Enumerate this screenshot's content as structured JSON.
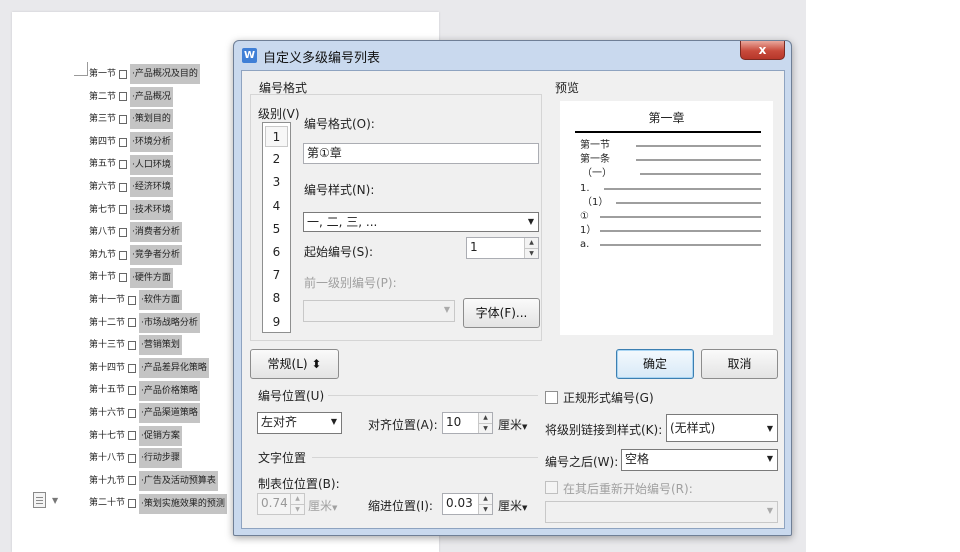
{
  "document": {
    "toc": [
      {
        "num": "第一节",
        "title": "·产品概况及目的"
      },
      {
        "num": "第二节",
        "title": "·产品概况"
      },
      {
        "num": "第三节",
        "title": "·策划目的"
      },
      {
        "num": "第四节",
        "title": "·环境分析"
      },
      {
        "num": "第五节",
        "title": "·人口环境"
      },
      {
        "num": "第六节",
        "title": "·经济环境"
      },
      {
        "num": "第七节",
        "title": "·技术环境"
      },
      {
        "num": "第八节",
        "title": "·消费者分析"
      },
      {
        "num": "第九节",
        "title": "·竞争者分析"
      },
      {
        "num": "第十节",
        "title": "·硬件方面"
      },
      {
        "num": "第十一节",
        "title": "·软件方面"
      },
      {
        "num": "第十二节",
        "title": "·市场战略分析"
      },
      {
        "num": "第十三节",
        "title": "·营销策划"
      },
      {
        "num": "第十四节",
        "title": "·产品差异化策略"
      },
      {
        "num": "第十五节",
        "title": "·产品价格策略"
      },
      {
        "num": "第十六节",
        "title": "·产品渠道策略"
      },
      {
        "num": "第十七节",
        "title": "·促销方案"
      },
      {
        "num": "第十八节",
        "title": "·行动步骤"
      },
      {
        "num": "第十九节",
        "title": "·广告及活动预算表"
      },
      {
        "num": "第二十节",
        "title": "·策划实施效果的预测"
      }
    ]
  },
  "dialog": {
    "title": "自定义多级编号列表",
    "app_icon": "W",
    "close_label": "x",
    "number_format_group": "编号格式",
    "level_label": "级别(V)",
    "levels": [
      "1",
      "2",
      "3",
      "4",
      "5",
      "6",
      "7",
      "8",
      "9"
    ],
    "selected_level": "1",
    "format_label": "编号格式(O):",
    "format_value": "第①章",
    "style_label": "编号样式(N):",
    "style_value": "一, 二, 三, ...",
    "start_label": "起始编号(S):",
    "start_value": "1",
    "prev_level_label": "前一级别编号(P):",
    "prev_level_value": "",
    "font_button": "字体(F)...",
    "preview_label": "预览",
    "preview": {
      "title": "第一章",
      "lines": [
        "第一节",
        "第一条",
        "（一）",
        "1.",
        "（1）",
        "①",
        "1）",
        "a."
      ]
    },
    "normal_button": "常规(L) ⬍",
    "ok_button": "确定",
    "cancel_button": "取消",
    "position_group": "编号位置(U)",
    "align_value": "左对齐",
    "align_pos_label": "对齐位置(A):",
    "align_pos_value": "10",
    "unit_value": "厘米",
    "text_pos_group": "文字位置",
    "tab_pos_label": "制表位位置(B):",
    "tab_pos_value": "0.74",
    "tab_unit": "厘米",
    "indent_label": "缩进位置(I):",
    "indent_value": "0.03",
    "indent_unit": "厘米",
    "legal_label": "正规形式编号(G)",
    "link_style_label": "将级别链接到样式(K):",
    "link_style_value": "(无样式)",
    "after_label": "编号之后(W):",
    "after_value": "空格",
    "restart_label": "在其后重新开始编号(R):",
    "restart_value": ""
  },
  "colors": {
    "dialog_frame": "#c9d9ee",
    "close_button": "#c84a3b",
    "highlight": "#c4c4c4"
  }
}
